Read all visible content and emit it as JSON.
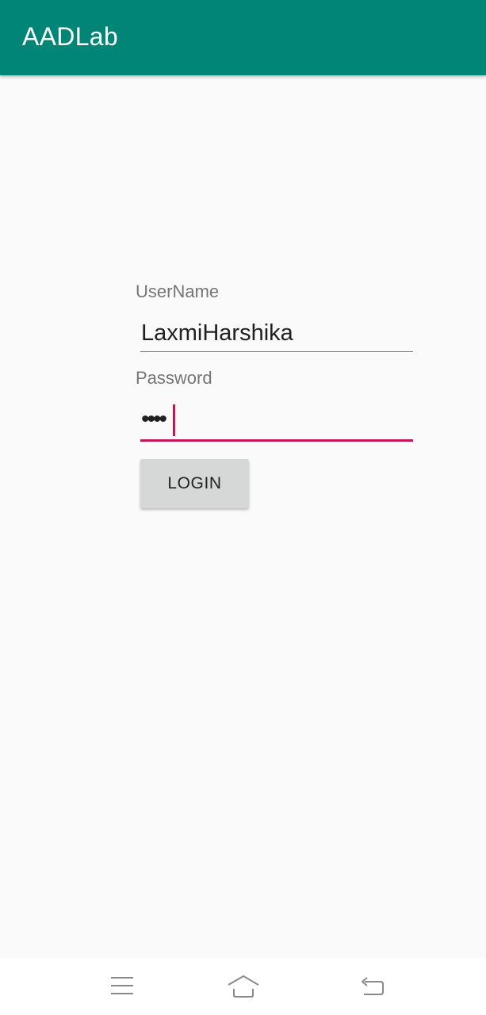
{
  "app_bar": {
    "title": "AADLab",
    "color": "#008577"
  },
  "form": {
    "username_label": "UserName",
    "username_value": "LaxmiHarshika",
    "password_label": "Password",
    "password_masked": "••••",
    "focus_color": "#c2185b",
    "login_label": "LOGIN"
  },
  "nav_bar": {
    "icons": [
      "menu-icon",
      "home-icon",
      "back-icon"
    ]
  }
}
